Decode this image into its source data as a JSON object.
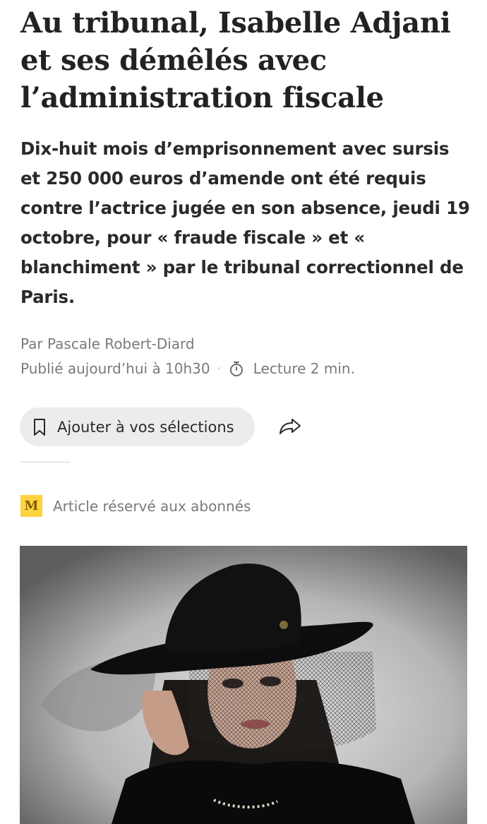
{
  "article": {
    "title": "Au tribunal, Isabelle Adjani et ses démêlés avec l’administration fiscale",
    "lede": "Dix-huit mois d’emprisonnement avec sursis et 250 000 euros d’amende ont été requis contre l’actrice jugée en son absence, jeudi 19 octobre, pour « fraude fiscale » et « blanchiment » par le tribunal correctionnel de Paris.",
    "byline": "Par Pascale Robert-Diard",
    "published": "Publié aujourd’hui à 10h30",
    "separator": "·",
    "reading_time": "Lecture 2 min."
  },
  "actions": {
    "save_label": "Ajouter à vos sélections"
  },
  "premium": {
    "logo_letter": "M",
    "label": "Article réservé aux abonnés",
    "accent_color": "#ffd23f"
  },
  "icons": {
    "timer": "stopwatch-icon",
    "bookmark": "bookmark-icon",
    "share": "share-arrow-icon"
  }
}
